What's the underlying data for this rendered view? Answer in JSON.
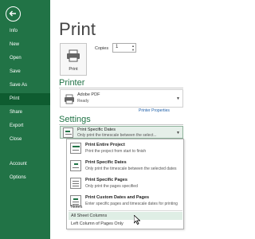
{
  "sidebar": {
    "back_icon": "arrow-left-circle-icon",
    "items": [
      {
        "label": "Info"
      },
      {
        "label": "New"
      },
      {
        "label": "Open"
      },
      {
        "label": "Save"
      },
      {
        "label": "Save As"
      },
      {
        "label": "Print",
        "selected": true
      },
      {
        "label": "Share"
      },
      {
        "label": "Export"
      },
      {
        "label": "Close"
      },
      {
        "label": "Account"
      },
      {
        "label": "Options"
      }
    ]
  },
  "main": {
    "title": "Print",
    "print_button": {
      "label": "Print",
      "icon": "printer-icon"
    },
    "copies": {
      "label": "Copies",
      "value": "1"
    },
    "printer_section": {
      "heading": "Printer",
      "name": "Adobe PDF",
      "status": "Ready",
      "properties_link": "Printer Properties"
    },
    "settings_section": {
      "heading": "Settings",
      "selected_title": "Print Specific Dates",
      "selected_desc": "Only print the timescale between the select..."
    },
    "menu": {
      "items": [
        {
          "title": "Print Entire Project",
          "desc": "Print the project from start to finish"
        },
        {
          "title": "Print Specific Dates",
          "desc": "Only print the timescale between the selected dates"
        },
        {
          "title": "Print Specific Pages",
          "desc": "Only print the pages specified"
        },
        {
          "title": "Print Custom Dates and Pages",
          "desc": "Enter specific pages and timescale dates for printing"
        }
      ],
      "options": [
        {
          "label": "Notes"
        },
        {
          "label": "All Sheet Columns",
          "hovered": true
        },
        {
          "label": "Left Column of Pages Only"
        }
      ]
    }
  },
  "colors": {
    "sidebar": "#217346",
    "sidebar_selected": "#0e5c30",
    "accent": "#217346",
    "hover": "#dfeee5"
  }
}
